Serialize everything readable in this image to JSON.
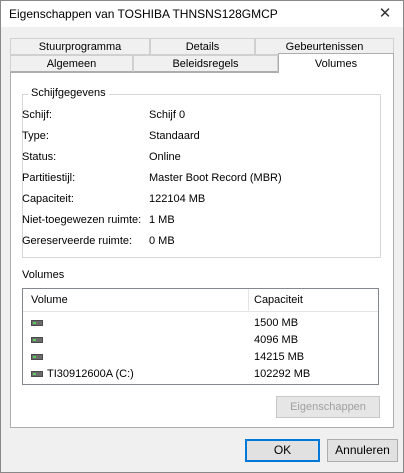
{
  "window": {
    "title": "Eigenschappen van TOSHIBA THNSNS128GMCP",
    "close_glyph": "✕"
  },
  "tabs_row1": [
    "Stuurprogramma",
    "Details",
    "Gebeurtenissen"
  ],
  "tabs_row2": [
    "Algemeen",
    "Beleidsregels",
    "Volumes"
  ],
  "active_tab": "Volumes",
  "disk_group": {
    "label": "Schijfgegevens",
    "rows": [
      {
        "label": "Schijf:",
        "value": "Schijf 0"
      },
      {
        "label": "Type:",
        "value": "Standaard"
      },
      {
        "label": "Status:",
        "value": "Online"
      },
      {
        "label": "Partitiestijl:",
        "value": "Master Boot Record (MBR)"
      },
      {
        "label": "Capaciteit:",
        "value": "122104 MB"
      },
      {
        "label": "Niet-toegewezen ruimte:",
        "value": "1 MB"
      },
      {
        "label": "Gereserveerde ruimte:",
        "value": "0 MB"
      }
    ]
  },
  "volumes_group": {
    "label": "Volumes",
    "columns": [
      "Volume",
      "Capaciteit"
    ],
    "rows": [
      {
        "name": "",
        "capacity": "1500 MB",
        "icon": "drive-icon"
      },
      {
        "name": "",
        "capacity": "4096 MB",
        "icon": "drive-icon"
      },
      {
        "name": "",
        "capacity": "14215 MB",
        "icon": "drive-icon"
      },
      {
        "name": "TI30912600A (C:)",
        "capacity": "102292 MB",
        "icon": "drive-icon"
      }
    ]
  },
  "buttons": {
    "properties": "Eigenschappen",
    "ok": "OK",
    "cancel": "Annuleren"
  },
  "colors": {
    "accent": "#0078d7",
    "drive_led": "#5ecb5e"
  }
}
